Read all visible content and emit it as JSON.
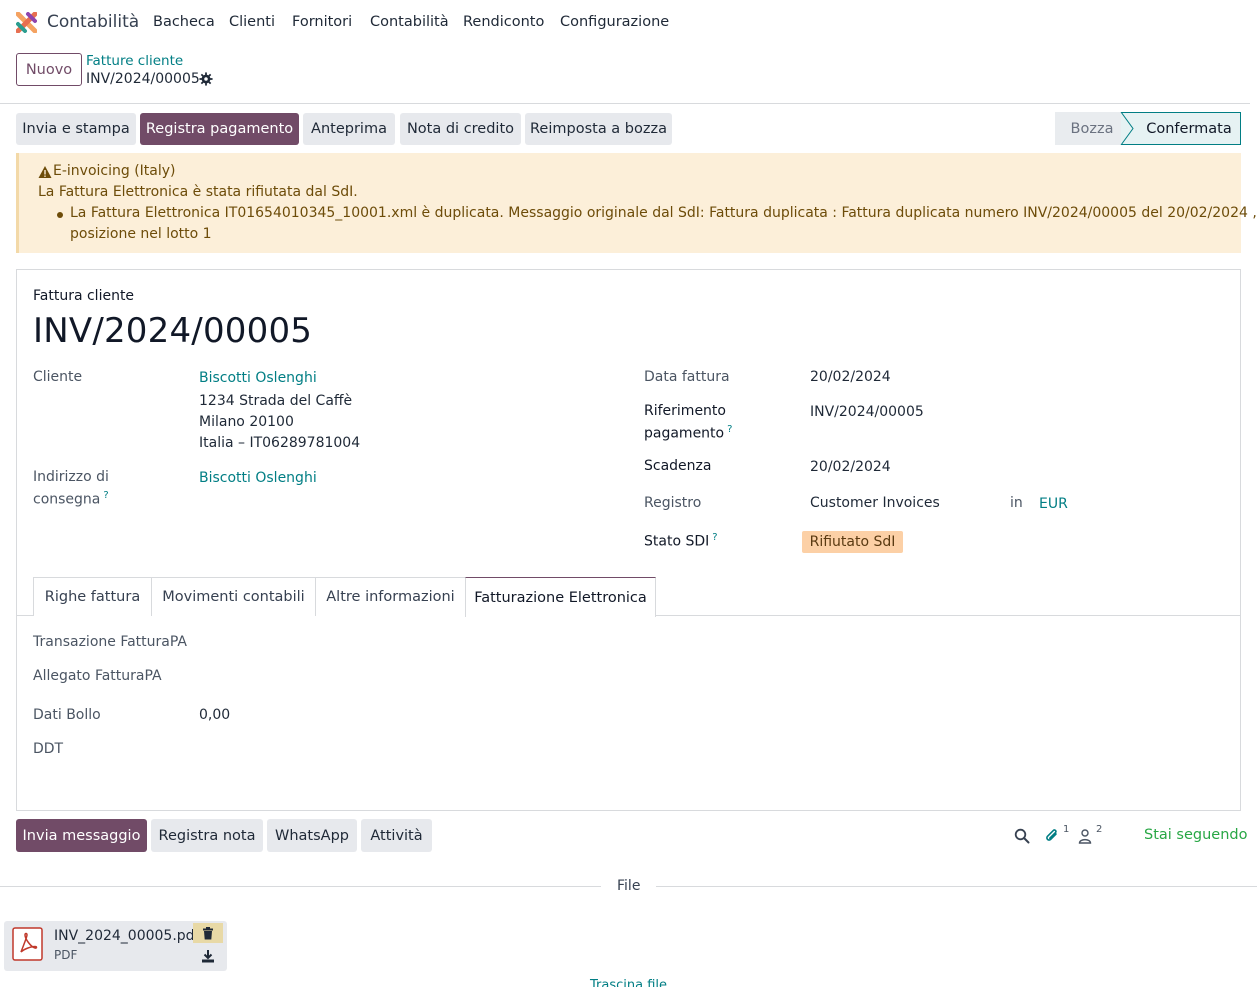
{
  "navbar": {
    "app_name": "Contabilità",
    "menu": [
      "Bacheca",
      "Clienti",
      "Fornitori",
      "Contabilità",
      "Rendiconto",
      "Configurazione"
    ]
  },
  "control": {
    "new_label": "Nuovo",
    "breadcrumb_parent": "Fatture cliente",
    "breadcrumb_current": "INV/2024/00005"
  },
  "actions": {
    "send_print": "Invia e stampa",
    "register_payment": "Registra pagamento",
    "preview": "Anteprima",
    "credit_note": "Nota di credito",
    "reset_draft": "Reimposta a bozza"
  },
  "status": {
    "draft": "Bozza",
    "confirmed": "Confermata"
  },
  "alert": {
    "title": "E-invoicing (Italy)",
    "message": "La Fattura Elettronica è stata rifiutata dal SdI.",
    "detail_line1": "La Fattura Elettronica IT01654010345_10001.xml è duplicata. Messaggio originale dal SdI: Fattura duplicata : Fattura duplicata numero INV/2024/00005 del 20/02/2024 ,",
    "detail_line2": "posizione nel lotto 1"
  },
  "form": {
    "doc_type": "Fattura cliente",
    "doc_name": "INV/2024/00005",
    "customer_label": "Cliente",
    "customer_name": "Biscotti Oslenghi",
    "address_line1": "1234 Strada del Caffè",
    "address_line2": "Milano 20100",
    "address_line3": "Italia – IT06289781004",
    "delivery_label_1": "Indirizzo di",
    "delivery_label_2": "consegna",
    "delivery_value": "Biscotti Oslenghi",
    "invoice_date_label": "Data fattura",
    "invoice_date": "20/02/2024",
    "payment_ref_label_1": "Riferimento",
    "payment_ref_label_2": "pagamento",
    "payment_ref": "INV/2024/00005",
    "due_label": "Scadenza",
    "due_date": "20/02/2024",
    "journal_label": "Registro",
    "journal": "Customer Invoices",
    "in_label": "in",
    "currency": "EUR",
    "sdi_label": "Stato SDI",
    "sdi_state": "Rifiutato SdI",
    "help_mark": "?"
  },
  "tabs": [
    "Righe fattura",
    "Movimenti contabili",
    "Altre informazioni",
    "Fatturazione Elettronica"
  ],
  "einvoice": {
    "transaction_label": "Transazione FatturaPA",
    "attachment_label": "Allegato FatturaPA",
    "stamp_label": "Dati Bollo",
    "stamp_value": "0,00",
    "ddt_label": "DDT"
  },
  "chatter": {
    "send_message": "Invia messaggio",
    "log_note": "Registra nota",
    "whatsapp": "WhatsApp",
    "activities": "Attività",
    "attachments_count": "1",
    "followers_count": "2",
    "following": "Stai seguendo",
    "files_title": "File",
    "attachment_name": "INV_2024_00005.pdf",
    "attachment_type": "PDF",
    "upload_label": "Trascina file"
  },
  "colors": {
    "brand": "#714B67",
    "link": "#017e84",
    "warning_bg": "#fcefd9",
    "badge_bg": "#fcd0a6",
    "following": "#28a745"
  }
}
